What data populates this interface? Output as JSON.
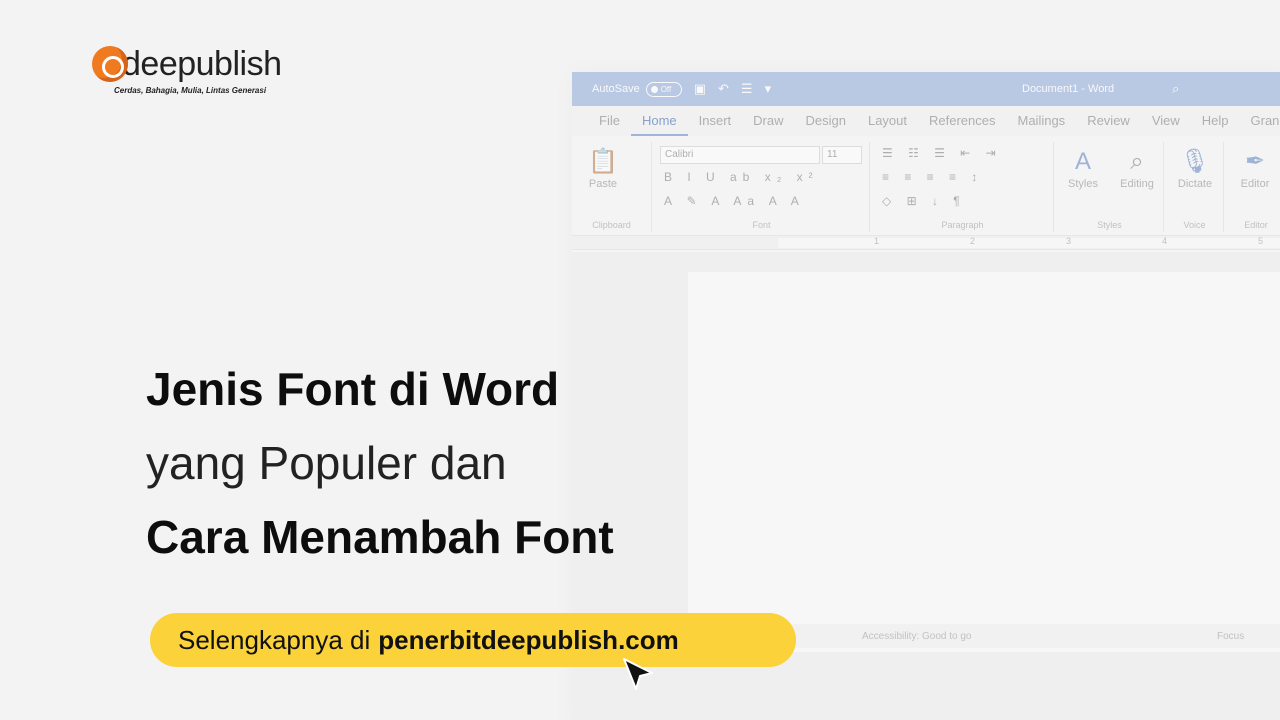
{
  "brand": {
    "name": "deepublish",
    "tagline": "Cerdas, Bahagia, Mulia, Lintas Generasi"
  },
  "headline": {
    "line1": "Jenis Font di Word",
    "line2": "yang Populer dan",
    "line3": "Cara Menambah Font"
  },
  "cta": {
    "prefix": "Selengkapnya di",
    "site": "penerbitdeepublish.com"
  },
  "word": {
    "autosave_label": "AutoSave",
    "autosave_state": "Off",
    "doc_title": "Document1 - Word",
    "tabs": [
      "File",
      "Home",
      "Insert",
      "Draw",
      "Design",
      "Layout",
      "References",
      "Mailings",
      "Review",
      "View",
      "Help",
      "Gran"
    ],
    "active_tab": "Home",
    "ribbon": {
      "paste_label": "Paste",
      "font_name": "Calibri",
      "font_size": "11",
      "styles_label": "Styles",
      "editing_label": "Editing",
      "dictate_label": "Dictate",
      "editor_label": "Editor",
      "groups": [
        "Clipboard",
        "Font",
        "Paragraph",
        "Styles",
        "Voice",
        "Editor"
      ]
    },
    "ruler_numbers": [
      "1",
      "2",
      "3",
      "4",
      "5"
    ],
    "status": {
      "accessibility": "Accessibility: Good to go",
      "focus": "Focus"
    }
  },
  "colors": {
    "brand_orange": "#f07a1f",
    "cta_yellow": "#fbd23a",
    "word_blue": "#8aa6d6"
  }
}
